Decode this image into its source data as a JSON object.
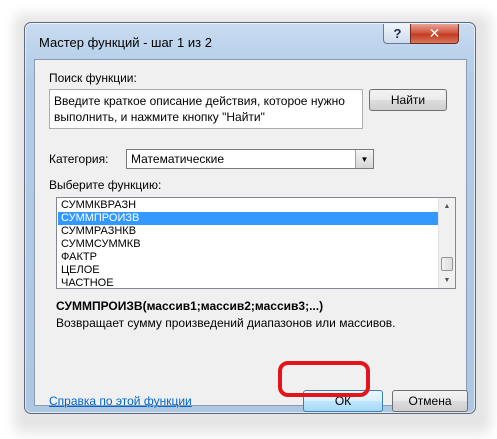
{
  "dialog": {
    "title": "Мастер функций - шаг 1 из 2",
    "help_button_glyph": "?",
    "close_button_glyph": "✕"
  },
  "search": {
    "label": "Поиск функции:",
    "value": "Введите краткое описание действия, которое нужно выполнить, и нажмите кнопку \"Найти\"",
    "find_button": "Найти"
  },
  "category": {
    "label": "Категория:",
    "selected": "Математические"
  },
  "function_list": {
    "label": "Выберите функцию:",
    "items": [
      "СУММКВРАЗН",
      "СУММПРОИЗВ",
      "СУММРАЗНКВ",
      "СУММСУММКВ",
      "ФАКТР",
      "ЦЕЛОЕ",
      "ЧАСТНОЕ"
    ],
    "selected_index": 1
  },
  "function_info": {
    "syntax": "СУММПРОИЗВ(массив1;массив2;массив3;...)",
    "description": "Возвращает сумму произведений диапазонов или массивов."
  },
  "footer": {
    "help_link": "Справка по этой функции",
    "ok_button": "ОК",
    "cancel_button": "Отмена"
  },
  "colors": {
    "selection": "#3399ff",
    "highlight": "#e3151a",
    "link": "#0066cc"
  }
}
